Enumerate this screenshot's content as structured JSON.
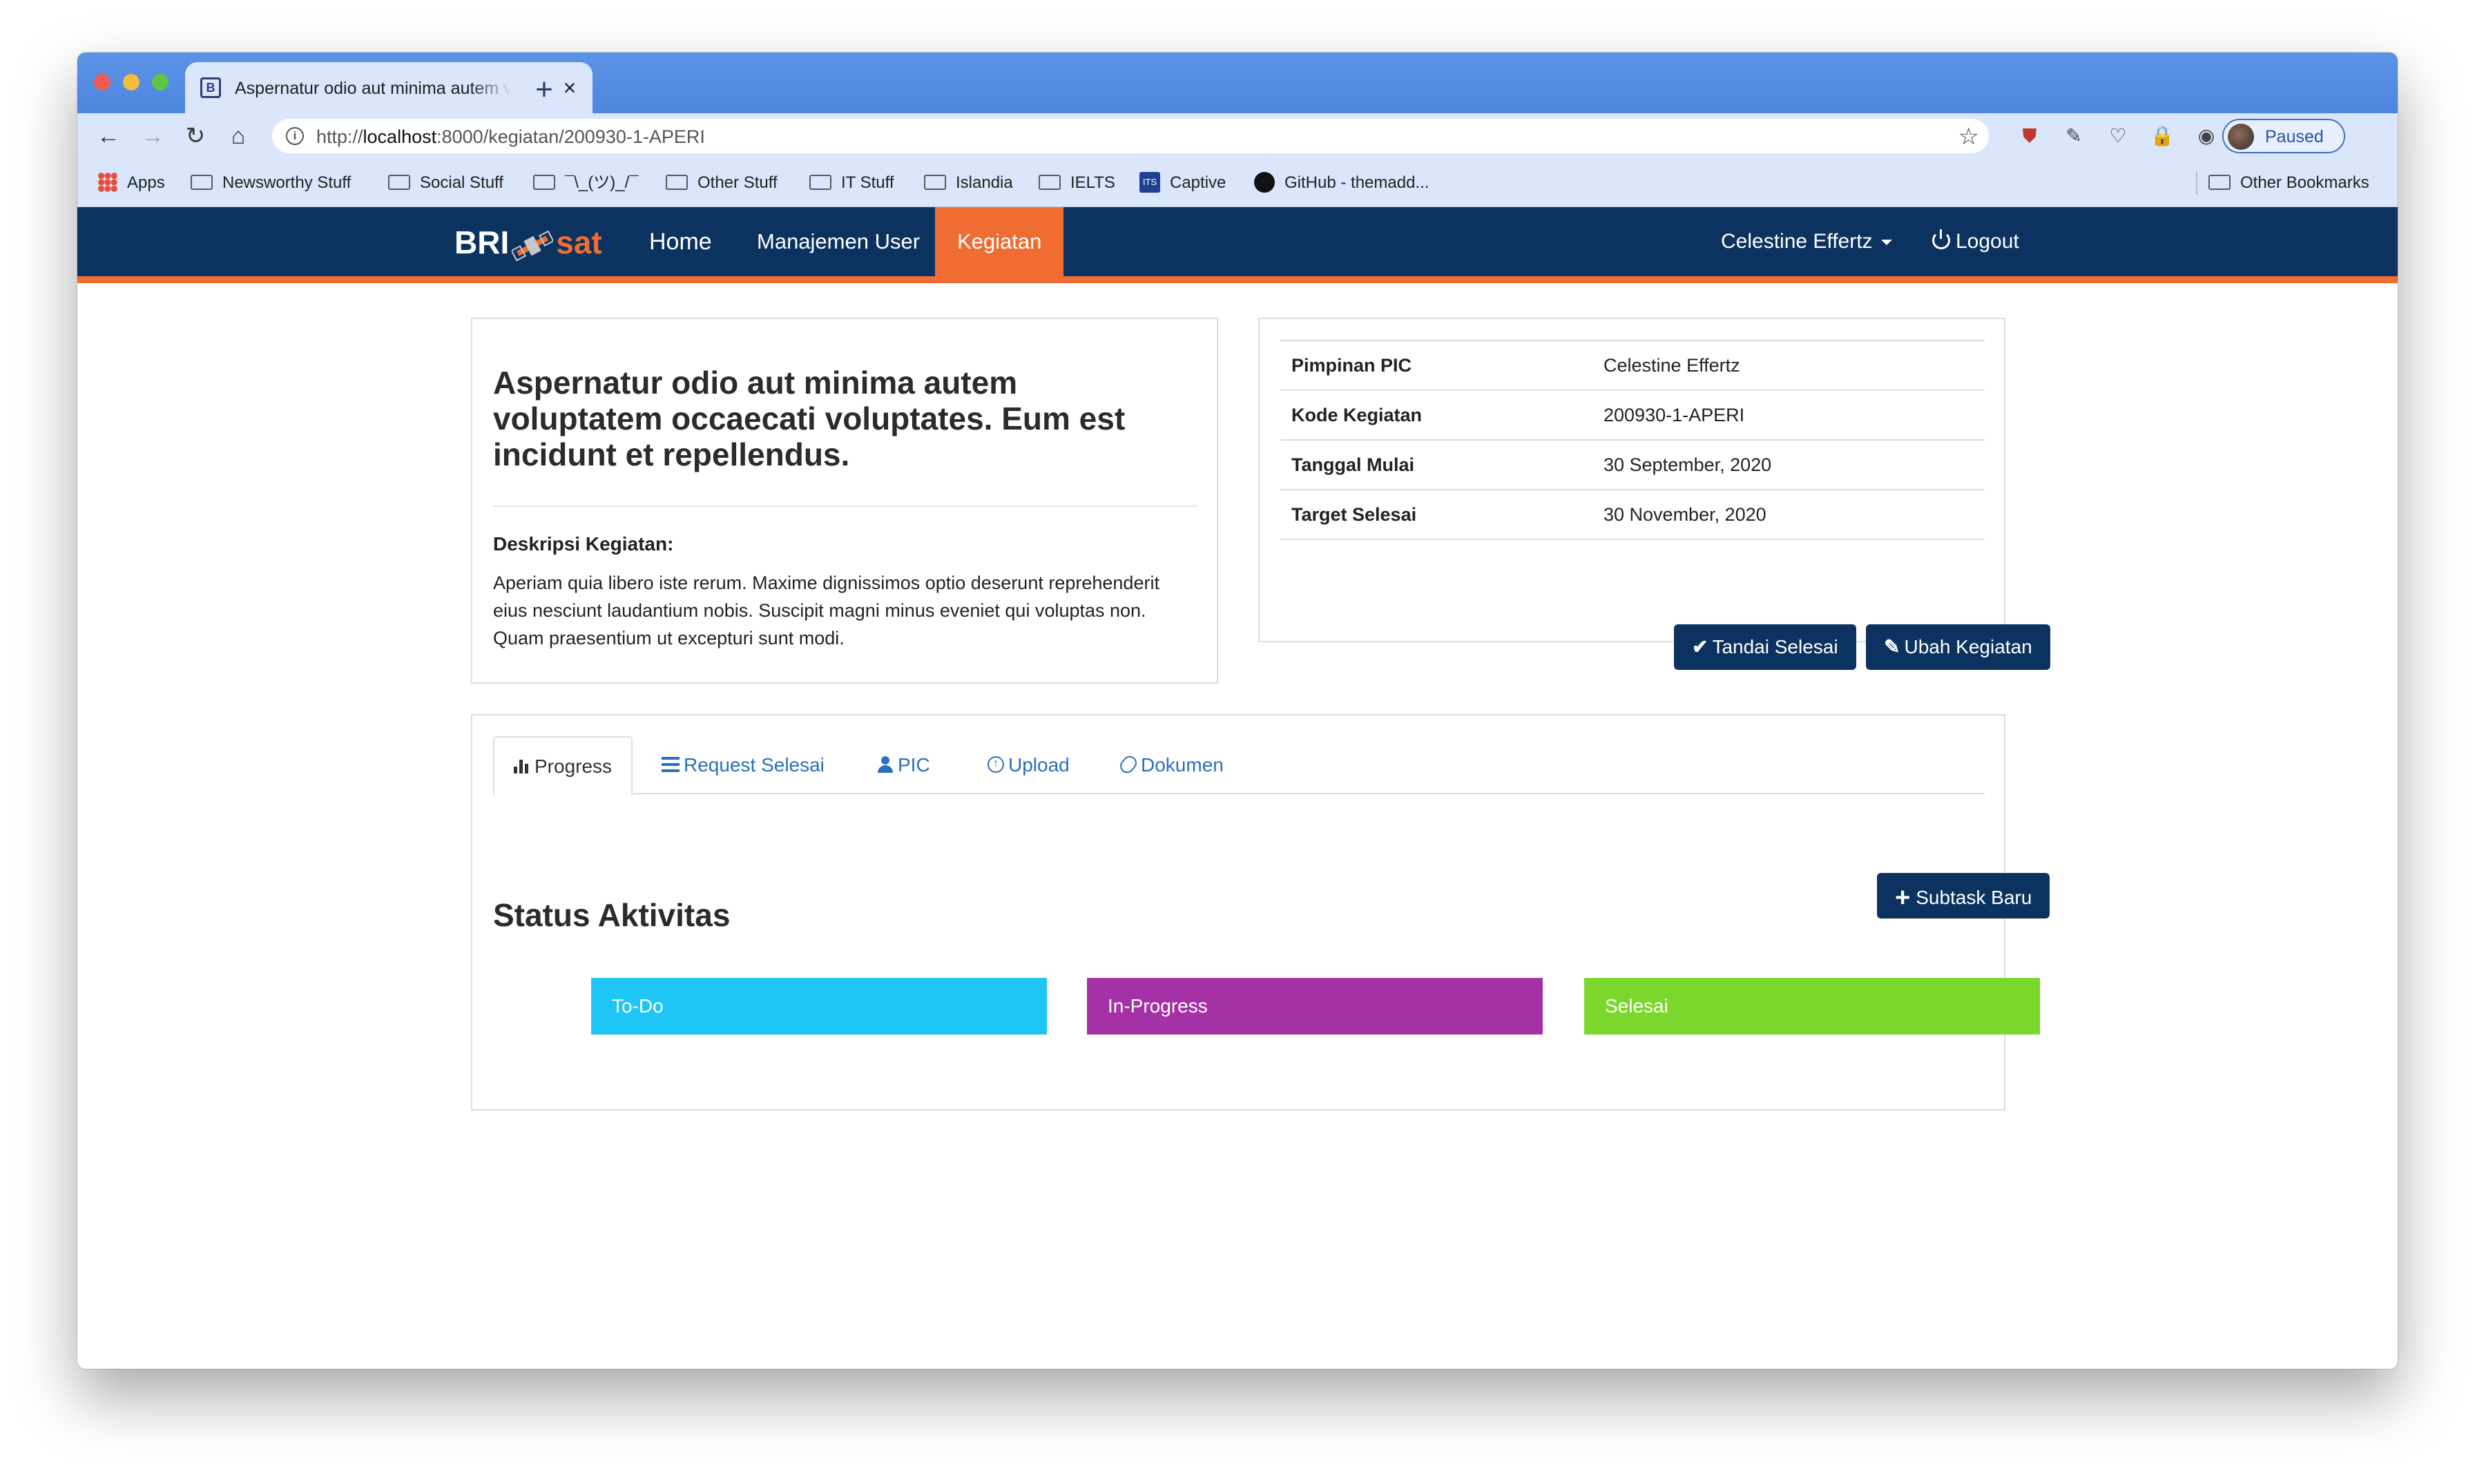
{
  "browser": {
    "tab_title": "Aspernatur odio aut minima autem voluptatem occaecati voluptates. Eum est incidunt et repellendus.",
    "url_prefix": "http://",
    "url_host": "localhost",
    "url_path": ":8000/kegiatan/200930-1-APERI",
    "profile_label": "Paused",
    "bookmarks": [
      {
        "label": "Apps",
        "icon": "apps-grid-icon"
      },
      {
        "label": "Newsworthy Stuff",
        "icon": "folder-icon"
      },
      {
        "label": "Social Stuff",
        "icon": "folder-icon"
      },
      {
        "label": "¯\\_(ツ)_/¯",
        "icon": "folder-icon"
      },
      {
        "label": "Other Stuff",
        "icon": "folder-icon"
      },
      {
        "label": "IT Stuff",
        "icon": "folder-icon"
      },
      {
        "label": "Islandia",
        "icon": "folder-icon"
      },
      {
        "label": "IELTS",
        "icon": "folder-icon"
      },
      {
        "label": "Captive",
        "icon": "its-logo-icon"
      },
      {
        "label": "GitHub - themadd...",
        "icon": "github-icon"
      },
      {
        "label": "Other Bookmarks",
        "icon": "folder-icon"
      }
    ]
  },
  "app": {
    "brand_primary": "BRI",
    "brand_secondary": "sat",
    "nav": {
      "home": "Home",
      "manajemen_user": "Manajemen User",
      "kegiatan": "Kegiatan",
      "user_name": "Celestine Effertz",
      "logout": "Logout"
    },
    "colors": {
      "navbar": "#0c3360",
      "accent": "#ef6d32",
      "todo": "#1ec6f5",
      "in_progress": "#a531a6",
      "selesai": "#7bd72b"
    }
  },
  "activity": {
    "title": "Aspernatur odio aut minima autem voluptatem occaecati voluptates. Eum est incidunt et repellendus.",
    "description_label": "Deskripsi Kegiatan:",
    "description": "Aperiam quia libero iste rerum. Maxime dignissimos optio deserunt reprehenderit eius nesciunt laudantium nobis. Suscipit magni minus eveniet qui voluptas non. Quam praesentium ut excepturi sunt modi."
  },
  "details": {
    "rows": [
      {
        "label": "Pimpinan PIC",
        "value": "Celestine Effertz"
      },
      {
        "label": "Kode Kegiatan",
        "value": "200930-1-APERI"
      },
      {
        "label": "Tanggal Mulai",
        "value": "30 September, 2020"
      },
      {
        "label": "Target Selesai",
        "value": "30 November, 2020"
      }
    ],
    "btn_done": "Tandai Selesai",
    "btn_edit": "Ubah Kegiatan"
  },
  "tabs": {
    "progress": "Progress",
    "request_selesai": "Request Selesai",
    "pic": "PIC",
    "upload": "Upload",
    "dokumen": "Dokumen"
  },
  "status": {
    "heading": "Status Aktivitas",
    "subtask_button": "Subtask Baru",
    "columns": {
      "todo": "To-Do",
      "in_progress": "In-Progress",
      "selesai": "Selesai"
    }
  }
}
